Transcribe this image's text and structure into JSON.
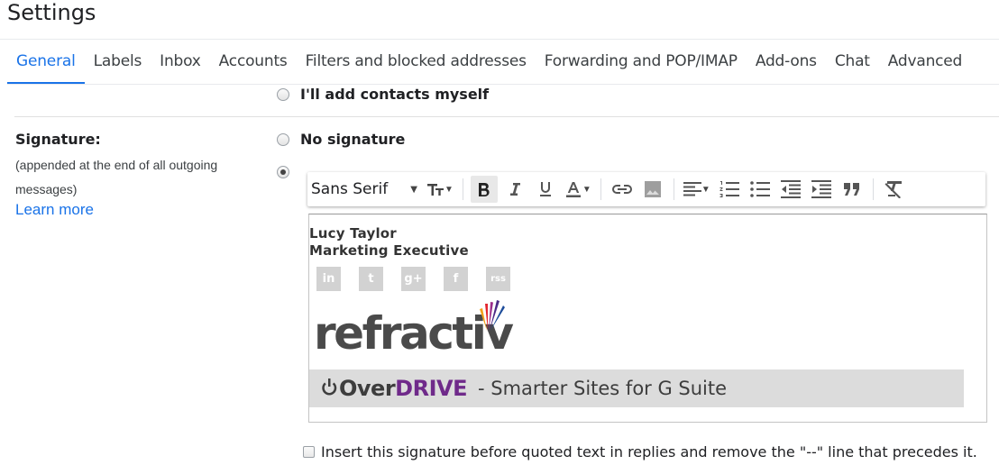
{
  "page": {
    "title": "Settings"
  },
  "tabs": [
    {
      "label": "General",
      "active": true
    },
    {
      "label": "Labels"
    },
    {
      "label": "Inbox"
    },
    {
      "label": "Accounts"
    },
    {
      "label": "Filters and blocked addresses"
    },
    {
      "label": "Forwarding and POP/IMAP"
    },
    {
      "label": "Add-ons"
    },
    {
      "label": "Chat"
    },
    {
      "label": "Advanced"
    }
  ],
  "contacts": {
    "option_manual": "I'll add contacts myself"
  },
  "signature": {
    "title": "Signature:",
    "description": "(appended at the end of all outgoing messages)",
    "learn_more": "Learn more",
    "option_none": "No signature",
    "selected": "custom"
  },
  "toolbar": {
    "font": "Sans Serif",
    "buttons": [
      "text-size",
      "bold",
      "italic",
      "underline",
      "text-color",
      "link",
      "image",
      "align",
      "numbered-list",
      "bulleted-list",
      "indent-less",
      "indent-more",
      "quote",
      "remove-formatting"
    ],
    "active": "bold"
  },
  "signature_content": {
    "name": "Lucy Taylor",
    "role": "Marketing Executive",
    "social_icons": [
      "linkedin-icon",
      "twitter-icon",
      "google-plus-icon",
      "facebook-icon",
      "rss-icon"
    ],
    "social_glyphs": [
      "in",
      "t",
      "g+",
      "f",
      "rss"
    ],
    "logo_text": "refractiv",
    "banner": {
      "logo_over": "Over",
      "logo_drive": "DRIVE",
      "tagline": "- Smarter Sites for G Suite"
    },
    "colors": {
      "banner_bg": "#dcdcdc",
      "drive_purple": "#6f2a8a"
    }
  },
  "insert_option": {
    "label": "Insert this signature before quoted text in replies and remove the \"--\" line that precedes it.",
    "checked": false
  },
  "colors": {
    "accent": "#1a73e8"
  }
}
